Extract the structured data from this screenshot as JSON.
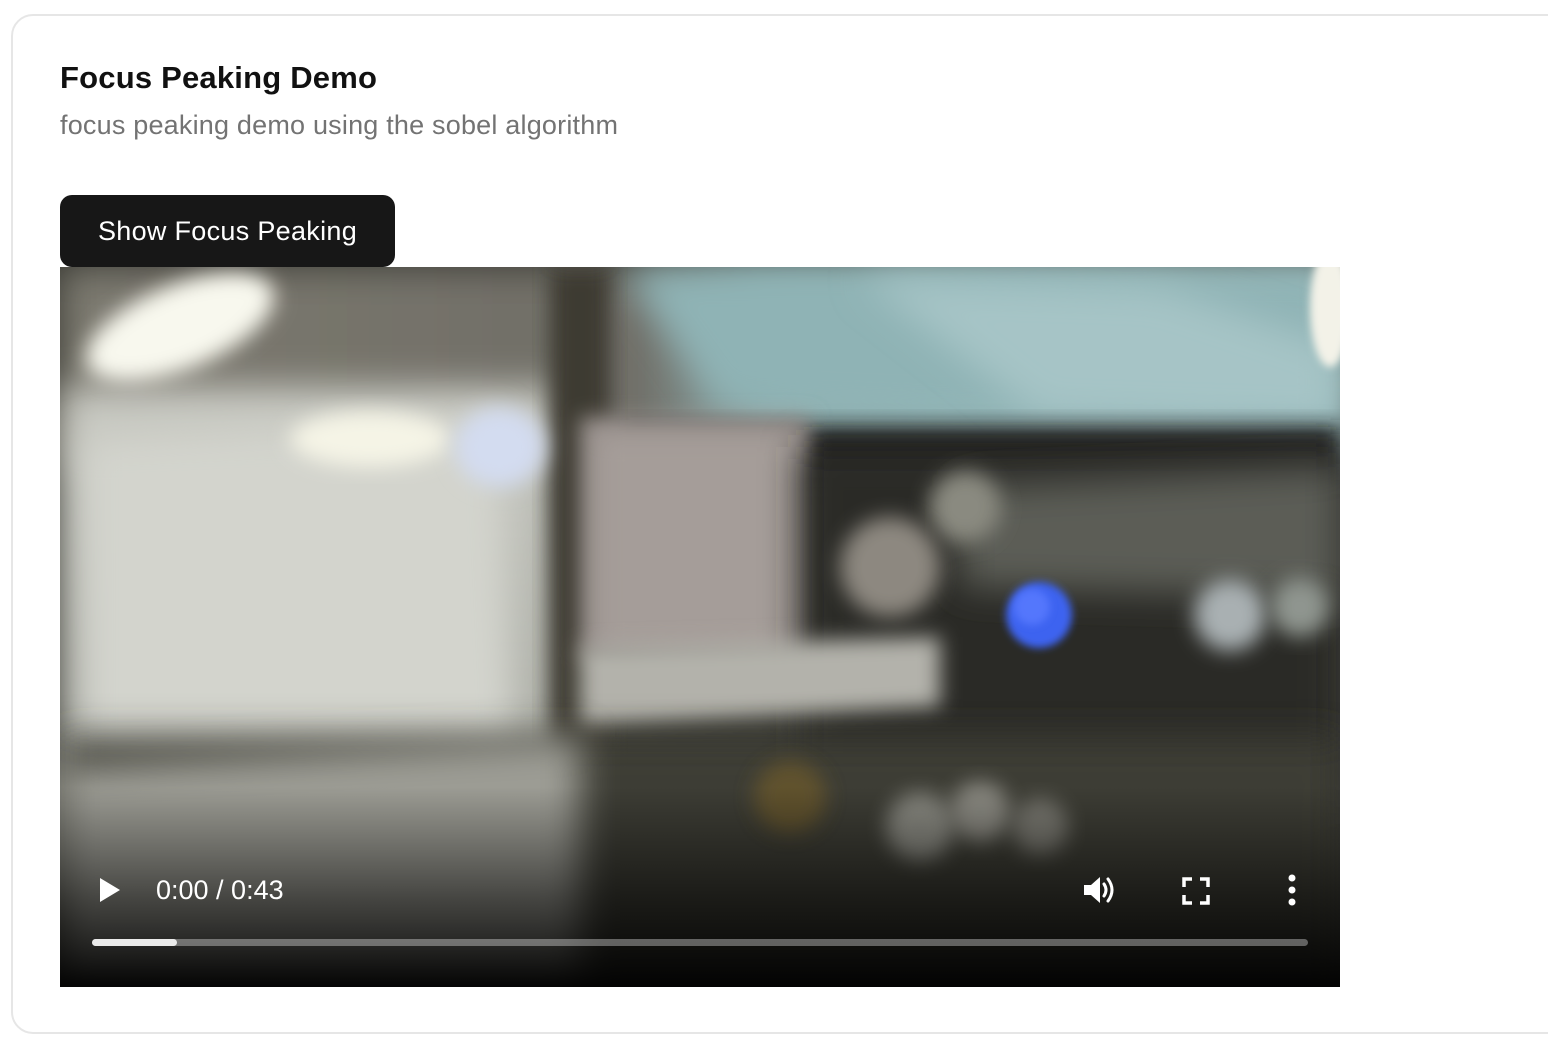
{
  "card": {
    "title": "Focus Peaking Demo",
    "subtitle": "focus peaking demo using the sobel algorithm"
  },
  "toolbar": {
    "toggle_label": "Show Focus Peaking"
  },
  "video": {
    "time_display": "0:00 / 0:43",
    "buffered_fraction": 0.07,
    "icons": {
      "play": "play-icon",
      "volume": "volume-icon",
      "fullscreen": "fullscreen-icon",
      "more": "more-vertical-icon"
    }
  },
  "colors": {
    "button_bg": "#171717",
    "button_text": "#ffffff",
    "title_text": "#111111",
    "subtitle_text": "#737373",
    "card_border": "#e6e6e6"
  }
}
